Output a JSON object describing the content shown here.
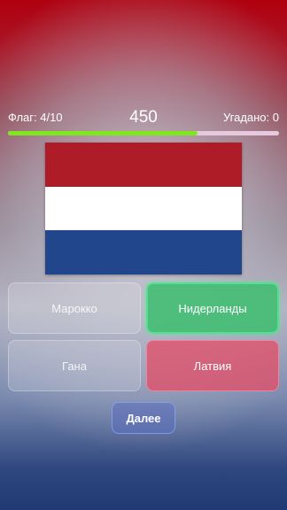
{
  "stats": {
    "flag_counter": "Флаг: 4/10",
    "score": "450",
    "guessed": "Угадано: 0"
  },
  "progress": {
    "fraction": 0.7,
    "fill_color": "#7ee81c",
    "track_color": "#e6c9df"
  },
  "flag": {
    "stripe_colors": [
      "#ae1c28",
      "#ffffff",
      "#21468b"
    ]
  },
  "answers": [
    {
      "label": "Марокко",
      "state": "neutral"
    },
    {
      "label": "Нидерланды",
      "state": "correct"
    },
    {
      "label": "Гана",
      "state": "neutral"
    },
    {
      "label": "Латвия",
      "state": "wrong"
    }
  ],
  "next_button": {
    "label": "Далее"
  }
}
